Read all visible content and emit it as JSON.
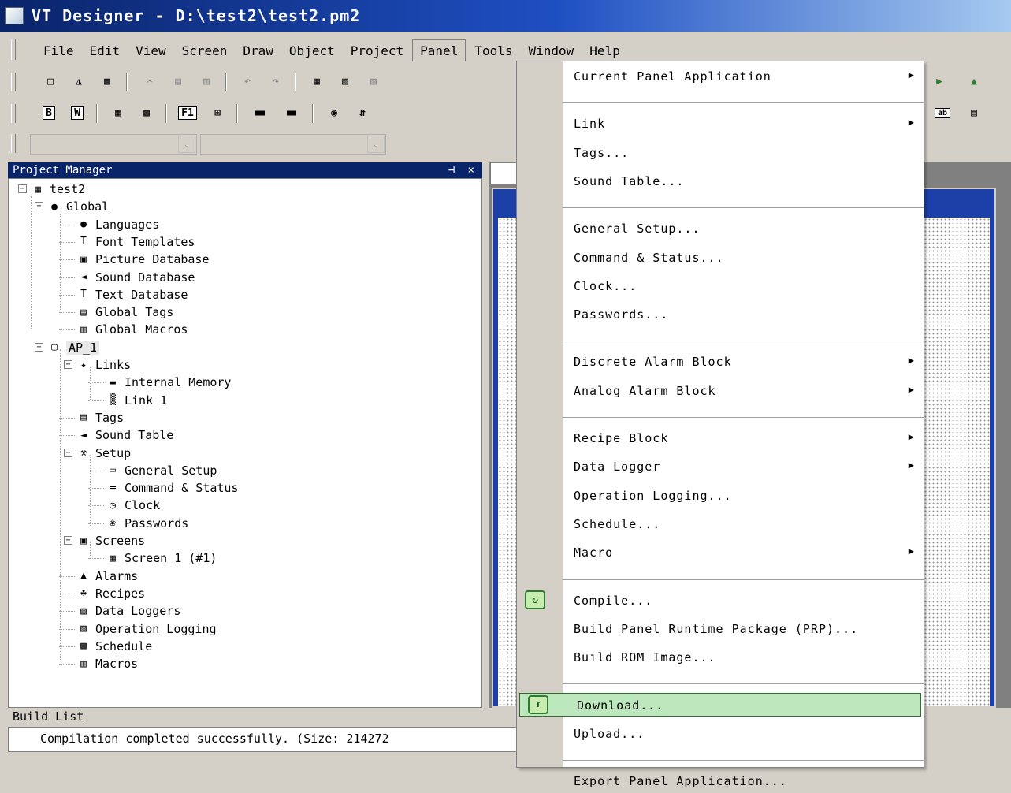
{
  "window": {
    "title": "VT Designer - D:\\test2\\test2.pm2"
  },
  "menubar": [
    {
      "label": "File"
    },
    {
      "label": "Edit"
    },
    {
      "label": "View"
    },
    {
      "label": "Screen"
    },
    {
      "label": "Draw"
    },
    {
      "label": "Object"
    },
    {
      "label": "Project"
    },
    {
      "label": "Panel",
      "active": true
    },
    {
      "label": "Tools"
    },
    {
      "label": "Window"
    },
    {
      "label": "Help"
    }
  ],
  "toolbar2": {
    "bold_label": "B",
    "w_label": "W",
    "f1_label": "F1"
  },
  "project_manager": {
    "title": "Project Manager",
    "controls": "⊣ ×",
    "tree": [
      {
        "label": "test2",
        "icon": "project-icon",
        "glyph": "▦",
        "depth": 0
      },
      {
        "label": "Global",
        "icon": "globe-pin-icon",
        "glyph": "●",
        "depth": 1
      },
      {
        "label": "Languages",
        "icon": "globe-icon",
        "glyph": "●",
        "depth": 2
      },
      {
        "label": "Font Templates",
        "icon": "font-icon",
        "glyph": "T",
        "depth": 2
      },
      {
        "label": "Picture Database",
        "icon": "picture-icon",
        "glyph": "▣",
        "depth": 2
      },
      {
        "label": "Sound Database",
        "icon": "speaker-icon",
        "glyph": "◄",
        "depth": 2
      },
      {
        "label": "Text Database",
        "icon": "text-db-icon",
        "glyph": "T",
        "depth": 2
      },
      {
        "label": "Global Tags",
        "icon": "tag-icon",
        "glyph": "▤",
        "depth": 2
      },
      {
        "label": "Global Macros",
        "icon": "macro-icon",
        "glyph": "▥",
        "depth": 2
      },
      {
        "label": "AP_1",
        "icon": "panel-icon",
        "glyph": "▢",
        "depth": 1,
        "selected": true
      },
      {
        "label": "Links",
        "icon": "links-icon",
        "glyph": "✦",
        "depth": 2
      },
      {
        "label": "Internal Memory",
        "icon": "memory-icon",
        "glyph": "▬",
        "depth": 3
      },
      {
        "label": "Link 1",
        "icon": "link-icon",
        "glyph": "▒",
        "depth": 3
      },
      {
        "label": "Tags",
        "icon": "tag-icon",
        "glyph": "▤",
        "depth": 2
      },
      {
        "label": "Sound Table",
        "icon": "sound-table-icon",
        "glyph": "◄",
        "depth": 2
      },
      {
        "label": "Setup",
        "icon": "wrench-icon",
        "glyph": "⚒",
        "depth": 2
      },
      {
        "label": "General Setup",
        "icon": "setup-icon",
        "glyph": "▭",
        "depth": 3
      },
      {
        "label": "Command & Status",
        "icon": "command-icon",
        "glyph": "═",
        "depth": 3
      },
      {
        "label": "Clock",
        "icon": "clock-icon",
        "glyph": "◷",
        "depth": 3
      },
      {
        "label": "Passwords",
        "icon": "password-icon",
        "glyph": "❀",
        "depth": 3
      },
      {
        "label": "Screens",
        "icon": "screens-icon",
        "glyph": "▣",
        "depth": 2
      },
      {
        "label": "Screen 1  (#1)",
        "icon": "screen-icon",
        "glyph": "▦",
        "depth": 3
      },
      {
        "label": "Alarms",
        "icon": "alarm-icon",
        "glyph": "▲",
        "depth": 2
      },
      {
        "label": "Recipes",
        "icon": "recipe-icon",
        "glyph": "☘",
        "depth": 2
      },
      {
        "label": "Data Loggers",
        "icon": "logger-icon",
        "glyph": "▧",
        "depth": 2
      },
      {
        "label": "Operation Logging",
        "icon": "operation-log-icon",
        "glyph": "▨",
        "depth": 2
      },
      {
        "label": "Schedule",
        "icon": "schedule-icon",
        "glyph": "▩",
        "depth": 2
      },
      {
        "label": "Macros",
        "icon": "macro-icon",
        "glyph": "▥",
        "depth": 2
      }
    ]
  },
  "build_list": {
    "title": "Build List",
    "message": "Compilation completed successfully.  (Size: 214272"
  },
  "panel_menu": {
    "items": [
      {
        "label": "Current Panel Application",
        "submenu": true
      },
      {
        "separator": true
      },
      {
        "label": "Link",
        "submenu": true
      },
      {
        "label": "Tags..."
      },
      {
        "label": "Sound Table..."
      },
      {
        "separator": true
      },
      {
        "label": "General Setup..."
      },
      {
        "label": "Command & Status..."
      },
      {
        "label": "Clock..."
      },
      {
        "label": "Passwords..."
      },
      {
        "separator": true
      },
      {
        "label": "Discrete Alarm Block",
        "submenu": true
      },
      {
        "label": "Analog Alarm Block",
        "submenu": true
      },
      {
        "separator": true
      },
      {
        "label": "Recipe Block",
        "submenu": true
      },
      {
        "label": "Data Logger",
        "submenu": true
      },
      {
        "label": "Operation Logging..."
      },
      {
        "label": "Schedule..."
      },
      {
        "label": "Macro",
        "submenu": true
      },
      {
        "separator": true
      },
      {
        "label": "Compile...",
        "icon": "compile-icon"
      },
      {
        "label": "Build Panel Runtime Package (PRP)..."
      },
      {
        "label": "Build ROM Image..."
      },
      {
        "separator": true
      },
      {
        "label": "Download...",
        "icon": "download-icon",
        "highlighted": true
      },
      {
        "label": "Upload..."
      },
      {
        "separator": true
      },
      {
        "label": "Export Panel Application..."
      }
    ]
  },
  "colors": {
    "title_bar": "#0a246a",
    "menu_highlight": "#bde7bd",
    "workspace_frame": "#1c3fa8"
  }
}
